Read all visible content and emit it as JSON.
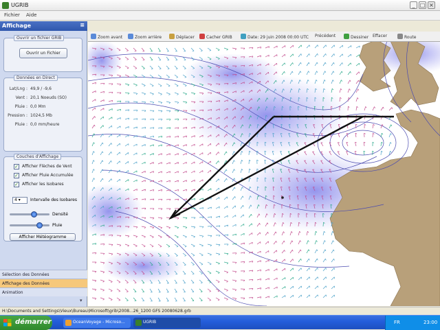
{
  "window": {
    "title": "UGRIB"
  },
  "menu": [
    "Fichier",
    "Aide"
  ],
  "panel": {
    "title": "Affichage",
    "file_group": {
      "title": "Ouvrir un fichier GRIB",
      "open_button": "Ouvrir un Fichier"
    },
    "data_group": {
      "title": "Données en Direct",
      "rows": [
        {
          "key": "Lat/Lng :",
          "value": "49,9 / -9,6"
        },
        {
          "key": "Vent :",
          "value": "20,1 Noeuds (SO)"
        },
        {
          "key": "Pluie :",
          "value": "0,0 Mm"
        },
        {
          "key": "Pression :",
          "value": "1024,5 Mb"
        },
        {
          "key": "Pluie :",
          "value": "0,0 mm/heure"
        }
      ]
    },
    "layers_group": {
      "title": "Couches d'Affichage",
      "checkboxes": [
        "Afficher Flèches de Vent",
        "Afficher Pluie Accumulée",
        "Afficher les Isobares"
      ],
      "interval_value": "4",
      "interval_label": "Intervalle des Isobares",
      "sliders": [
        {
          "label": "Densité",
          "value": 0.62
        },
        {
          "label": "Pluie",
          "value": 0.75
        }
      ],
      "meteogram_button": "Afficher Météogramme"
    },
    "tabs": [
      "Sélection des Données",
      "Affichage des Données",
      "Animation"
    ]
  },
  "toolbar": [
    "Zoom avant",
    "Zoom arrière",
    "Déplacer",
    "Cacher GRIB",
    "Date: 29 juin 2008 00:00 UTC",
    "Précédent",
    "Dessiner",
    "Effacer",
    "Route"
  ],
  "status": "H:\\Documents and Settings\\Vieux\\Bureau\\Microsoft\\grib\\2008...26_1200 GFS 20080628.grb",
  "taskbar": {
    "start": "démarrer",
    "tasks": [
      "OceanVoyage - Microso...",
      "UGRIB"
    ],
    "lang": "FR",
    "clock": "23:00"
  },
  "colors": {
    "sea": "#ffffff",
    "land": "#b8a07a",
    "rain": "#8c8cf0",
    "isobar": "#4a4ab0",
    "route": "#111111"
  }
}
